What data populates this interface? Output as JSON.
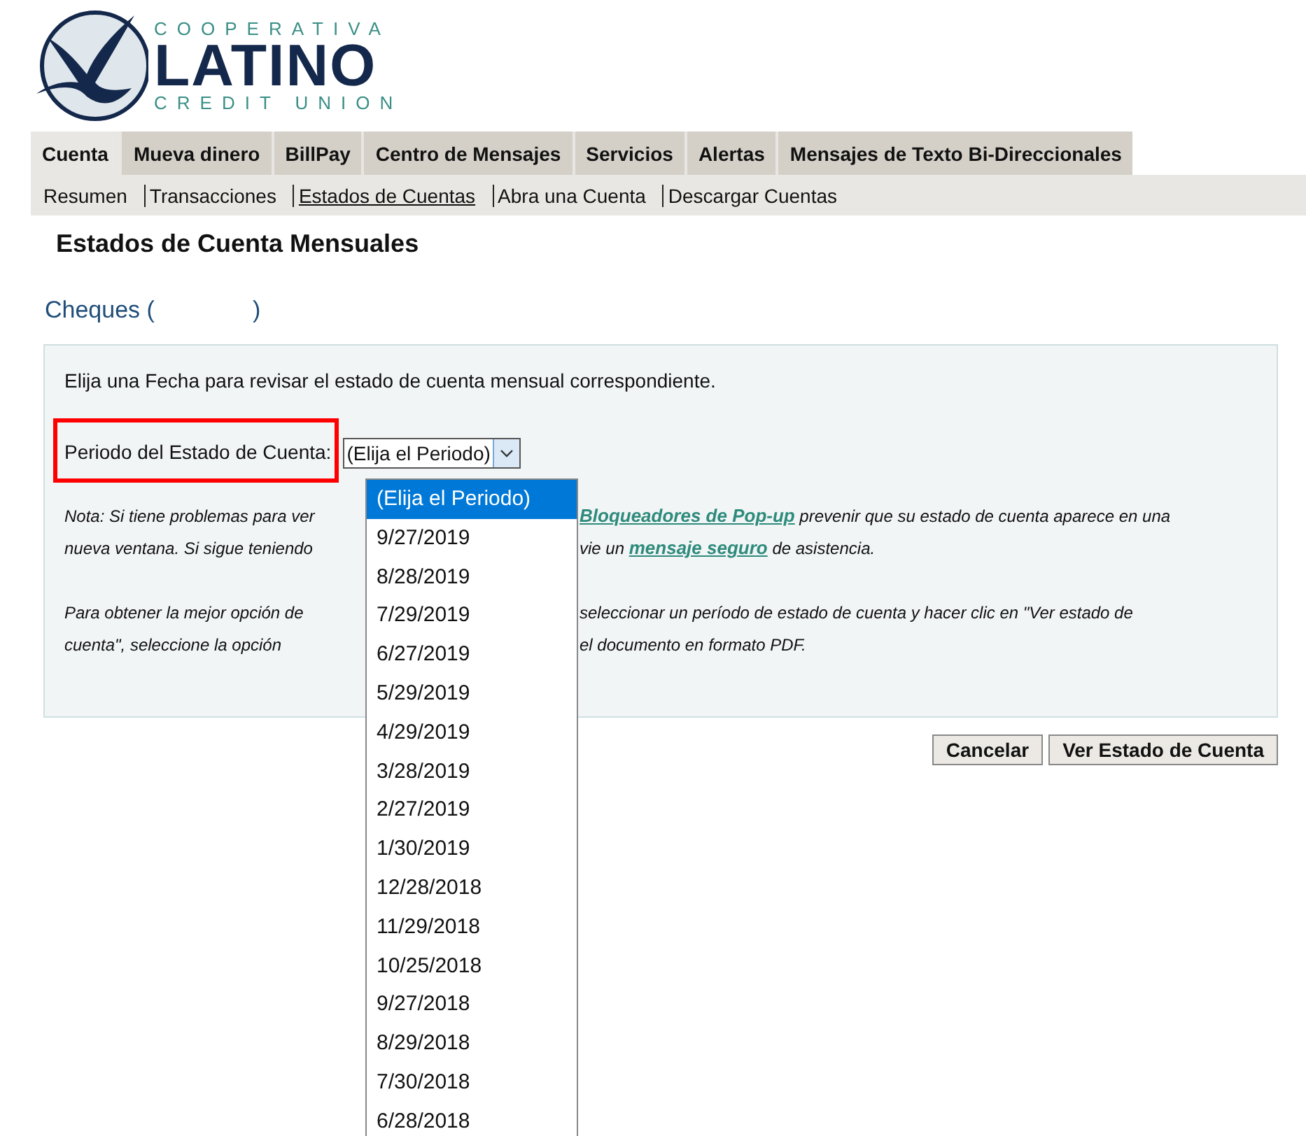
{
  "logo": {
    "top": "COOPERATIVA",
    "main": "LATINO",
    "bottom": "CREDIT UNION"
  },
  "tabs": [
    {
      "label": "Cuenta",
      "selected": true
    },
    {
      "label": "Mueva dinero",
      "selected": false
    },
    {
      "label": "BillPay",
      "selected": false
    },
    {
      "label": "Centro de Mensajes",
      "selected": false
    },
    {
      "label": "Servicios",
      "selected": false
    },
    {
      "label": "Alertas",
      "selected": false
    },
    {
      "label": "Mensajes de Texto Bi-Direccionales",
      "selected": false
    }
  ],
  "subnav": [
    {
      "label": "Resumen",
      "selected": false
    },
    {
      "label": "Transacciones",
      "selected": false
    },
    {
      "label": "Estados de Cuentas",
      "selected": true
    },
    {
      "label": "Abra una Cuenta",
      "selected": false
    },
    {
      "label": "Descargar Cuentas",
      "selected": false
    }
  ],
  "page_title": "Estados de Cuenta Mensuales",
  "account": {
    "open": "Cheques (",
    "close": ")"
  },
  "panel": {
    "intro": "Elija una Fecha para revisar el estado de cuenta mensual correspondiente.",
    "period_label": "Periodo del Estado de Cuenta:",
    "period_value": "(Elija el Periodo)",
    "note_lines": [
      {
        "gap": false,
        "left": "Nota: Si tiene problemas para ver",
        "right": [
          {
            "text": "Bloqueadores de Pop-up",
            "link": true
          },
          {
            "text": " prevenir que su estado de cuenta aparece en una",
            "link": false
          }
        ]
      },
      {
        "gap": false,
        "left": "nueva ventana. Si sigue teniendo",
        "right": [
          {
            "text": "vie un ",
            "link": false
          },
          {
            "text": "mensaje seguro",
            "link": true
          },
          {
            "text": " de asistencia.",
            "link": false
          }
        ]
      },
      {
        "gap": true,
        "left": "Para obtener la mejor opción de",
        "right": [
          {
            "text": "seleccionar un período de estado de cuenta y hacer clic en \"Ver estado de",
            "link": false
          }
        ]
      },
      {
        "gap": false,
        "left": "cuenta\", seleccione la opción",
        "right": [
          {
            "text": "el documento en formato PDF.",
            "link": false
          }
        ]
      }
    ]
  },
  "buttons": [
    "Cancelar",
    "Ver Estado de Cuenta"
  ],
  "dropdown_options": [
    {
      "label": "(Elija el Periodo)",
      "selected": true
    },
    {
      "label": "9/27/2019",
      "selected": false
    },
    {
      "label": "8/28/2019",
      "selected": false
    },
    {
      "label": "7/29/2019",
      "selected": false
    },
    {
      "label": "6/27/2019",
      "selected": false
    },
    {
      "label": "5/29/2019",
      "selected": false
    },
    {
      "label": "4/29/2019",
      "selected": false
    },
    {
      "label": "3/28/2019",
      "selected": false
    },
    {
      "label": "2/27/2019",
      "selected": false
    },
    {
      "label": "1/30/2019",
      "selected": false
    },
    {
      "label": "12/28/2018",
      "selected": false
    },
    {
      "label": "11/29/2018",
      "selected": false
    },
    {
      "label": "10/25/2018",
      "selected": false
    },
    {
      "label": "9/27/2018",
      "selected": false
    },
    {
      "label": "8/29/2018",
      "selected": false
    },
    {
      "label": "7/30/2018",
      "selected": false
    },
    {
      "label": "6/28/2018",
      "selected": false
    }
  ]
}
